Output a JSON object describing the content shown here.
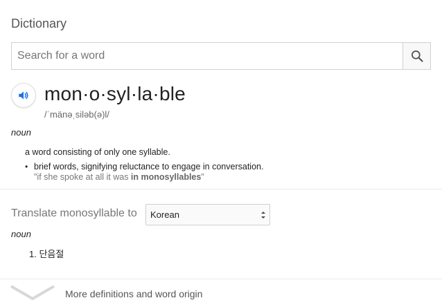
{
  "panel": {
    "title": "Dictionary"
  },
  "search": {
    "placeholder": "Search for a word",
    "value": ""
  },
  "entry": {
    "word": "mon·o·syl·la·ble",
    "phonetic": "/ˈmänəˌsiləb(ə)l/",
    "part_of_speech": "noun",
    "definitions": [
      {
        "text": "a word consisting of only one syllable."
      },
      {
        "text": "brief words, signifying reluctance to engage in conversation.",
        "example_prefix": "\"if she spoke at all it was ",
        "example_bold": "in monosyllables",
        "example_suffix": "\""
      }
    ]
  },
  "translate": {
    "label": "Translate monosyllable to",
    "language": "Korean",
    "part_of_speech": "noun",
    "items": [
      "1. 단음절"
    ]
  },
  "footer": {
    "more_label": "More definitions and word origin"
  },
  "icons": {
    "search": "search-icon",
    "speaker": "speaker-icon",
    "select_arrows": "select-arrows-icon",
    "expand": "chevron-down-icon"
  },
  "colors": {
    "accent": "#1a73e8",
    "muted": "#777777"
  }
}
